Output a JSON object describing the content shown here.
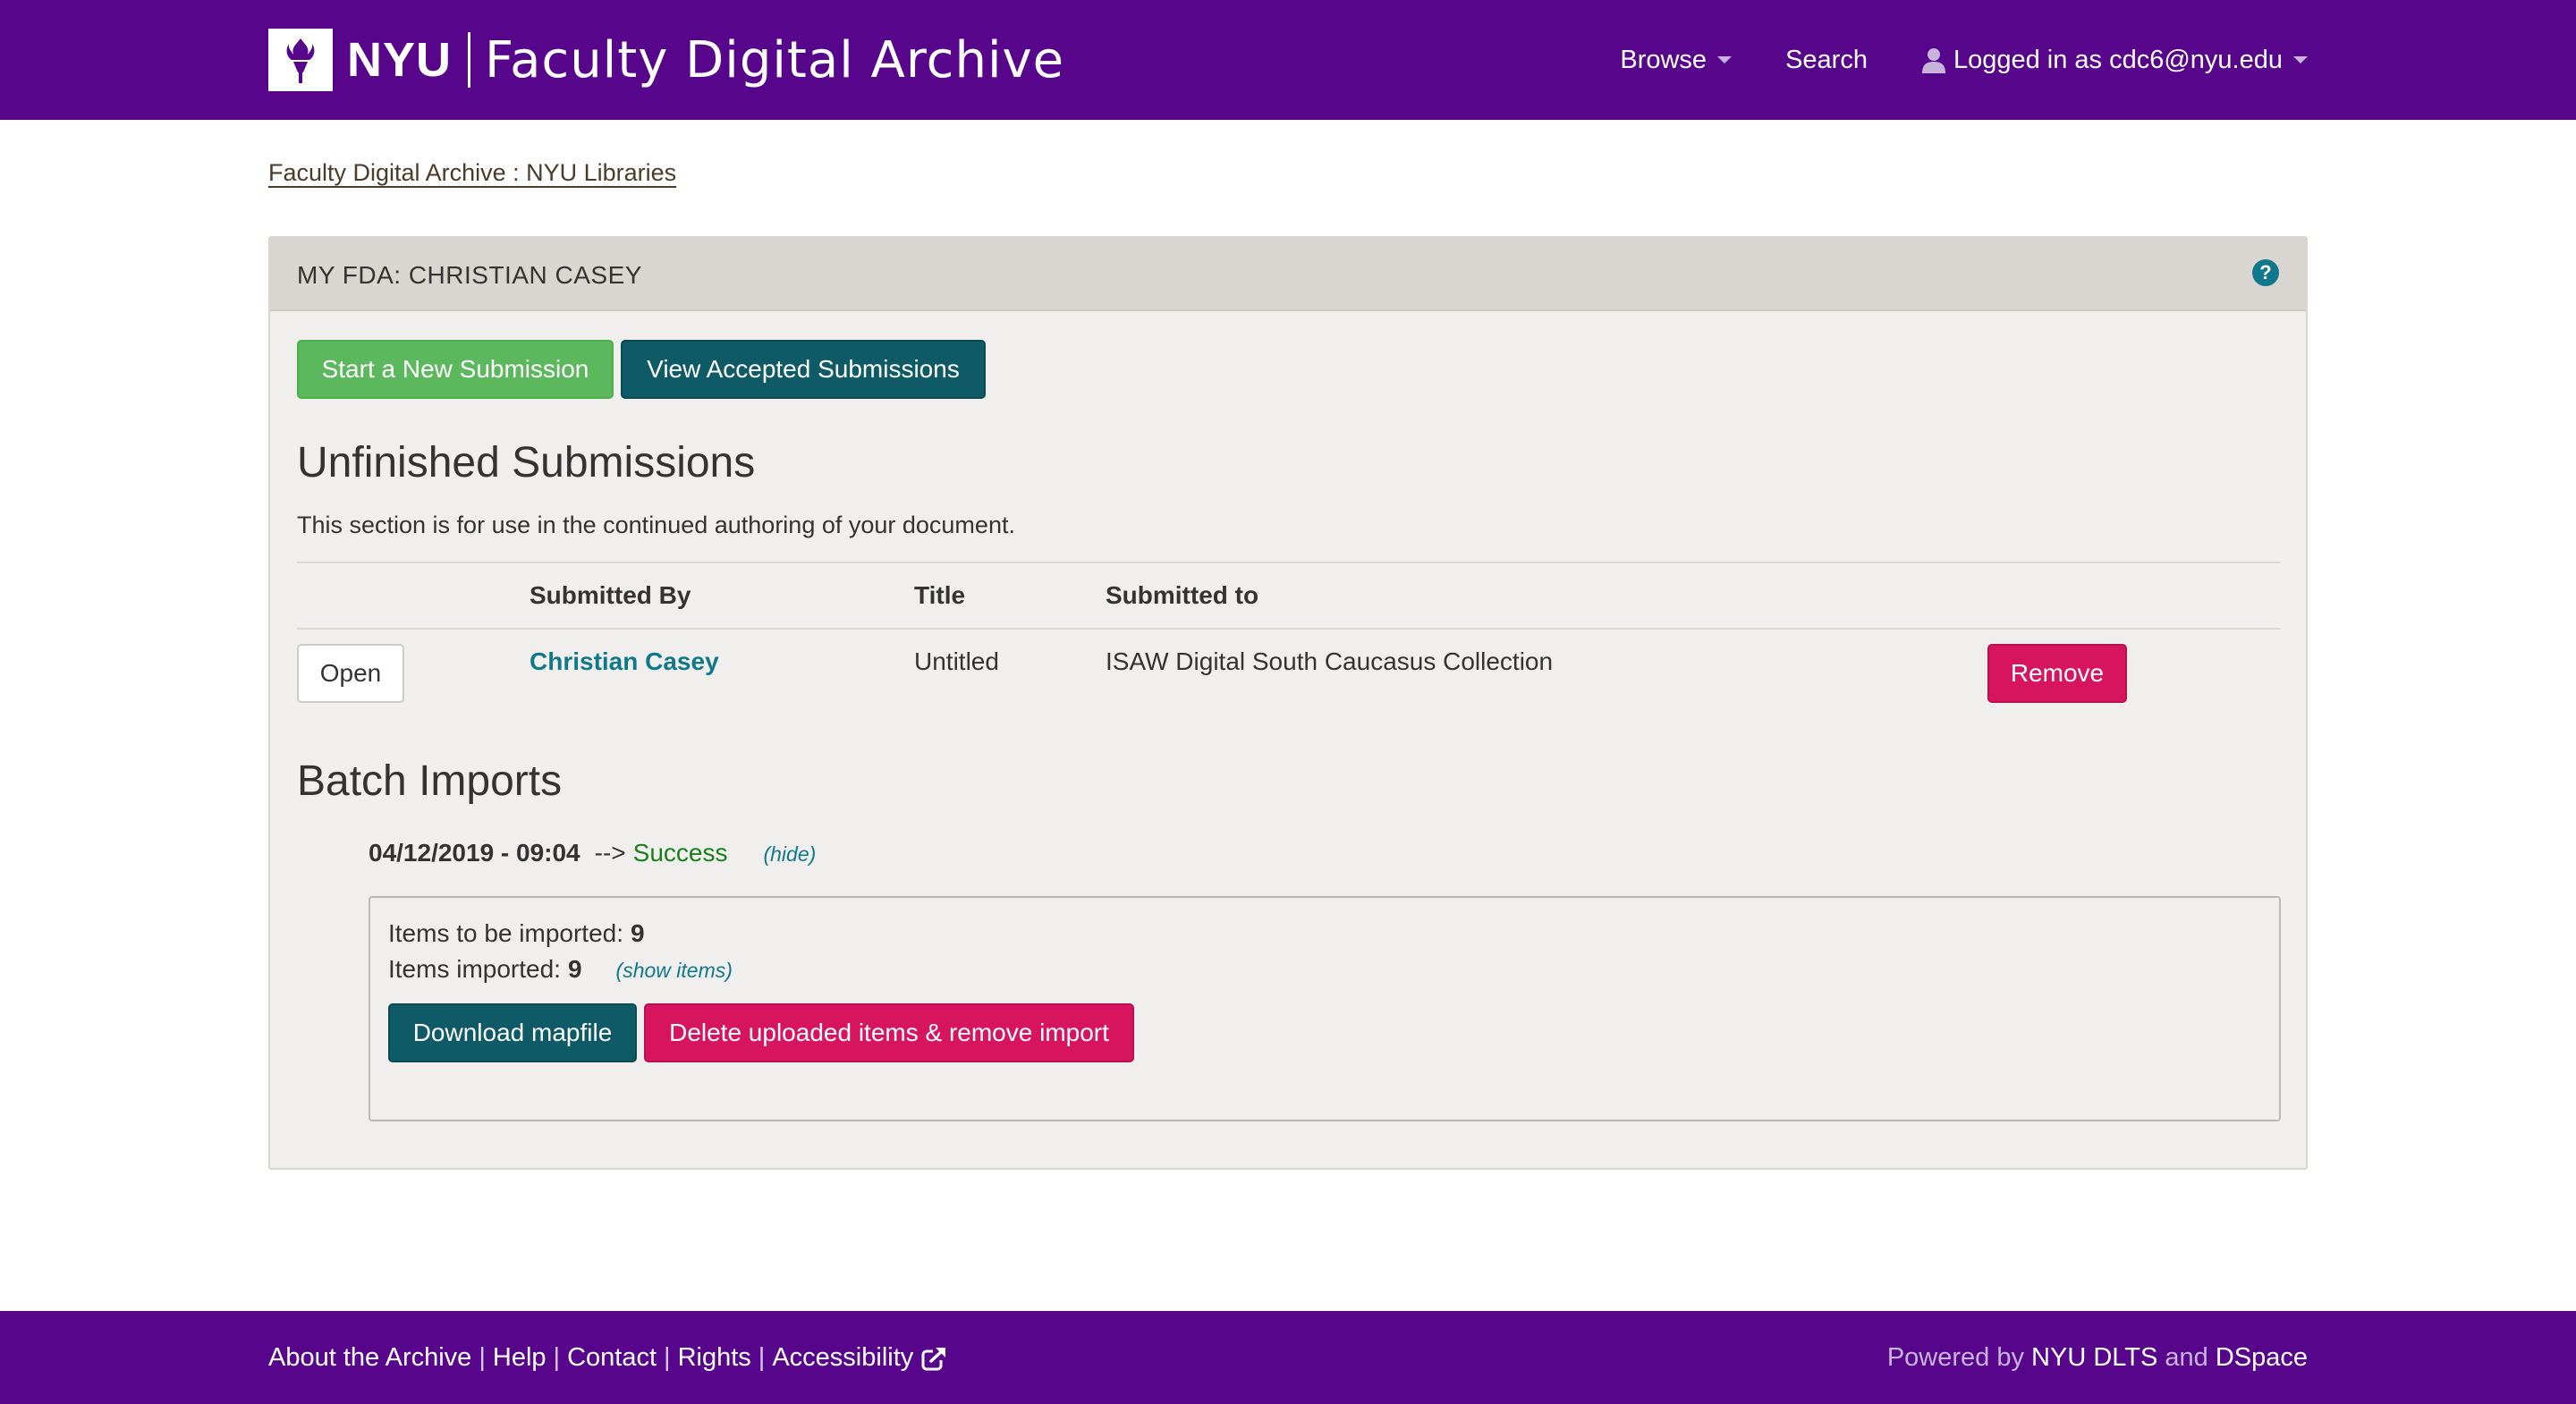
{
  "header": {
    "logo_text": "NYU",
    "site_name": "Faculty Digital Archive",
    "nav": {
      "browse": "Browse",
      "search": "Search",
      "user": "Logged in as cdc6@nyu.edu"
    },
    "icons": {
      "logo": "torch-icon",
      "user": "user-icon",
      "caret": "caret-down-icon"
    }
  },
  "breadcrumb": "Faculty Digital Archive : NYU Libraries",
  "panel": {
    "title": "MY FDA: CHRISTIAN CASEY",
    "help": "?",
    "buttons": {
      "new_submission": "Start a New Submission",
      "view_accepted": "View Accepted Submissions"
    }
  },
  "unfinished": {
    "heading": "Unfinished Submissions",
    "description": "This section is for use in the continued authoring of your document.",
    "columns": [
      "Submitted By",
      "Title",
      "Submitted to"
    ],
    "rows": [
      {
        "open": "Open",
        "submitted_by": "Christian Casey",
        "title": "Untitled",
        "submitted_to": "ISAW Digital South Caucasus Collection",
        "remove": "Remove"
      }
    ]
  },
  "batch": {
    "heading": "Batch Imports",
    "date": "04/12/2019 - 09:04",
    "arrow": "-->",
    "status": "Success",
    "hide": "(hide)",
    "to_be_imported_label": "Items to be imported:",
    "to_be_imported": "9",
    "imported_label": "Items imported:",
    "imported": "9",
    "show_items": "(show items)",
    "download": "Download mapfile",
    "delete": "Delete uploaded items & remove import"
  },
  "footer": {
    "links": [
      "About the Archive",
      "Help",
      "Contact",
      "Rights",
      "Accessibility"
    ],
    "sep": "|",
    "powered_prefix": "Powered by",
    "powered_a": "NYU DLTS",
    "powered_and": "and",
    "powered_b": "DSpace"
  },
  "colors": {
    "brand": "#57068c",
    "teal": "#0e5a66",
    "green": "#5cb85c",
    "pink": "#d7155f",
    "link": "#11788a"
  }
}
